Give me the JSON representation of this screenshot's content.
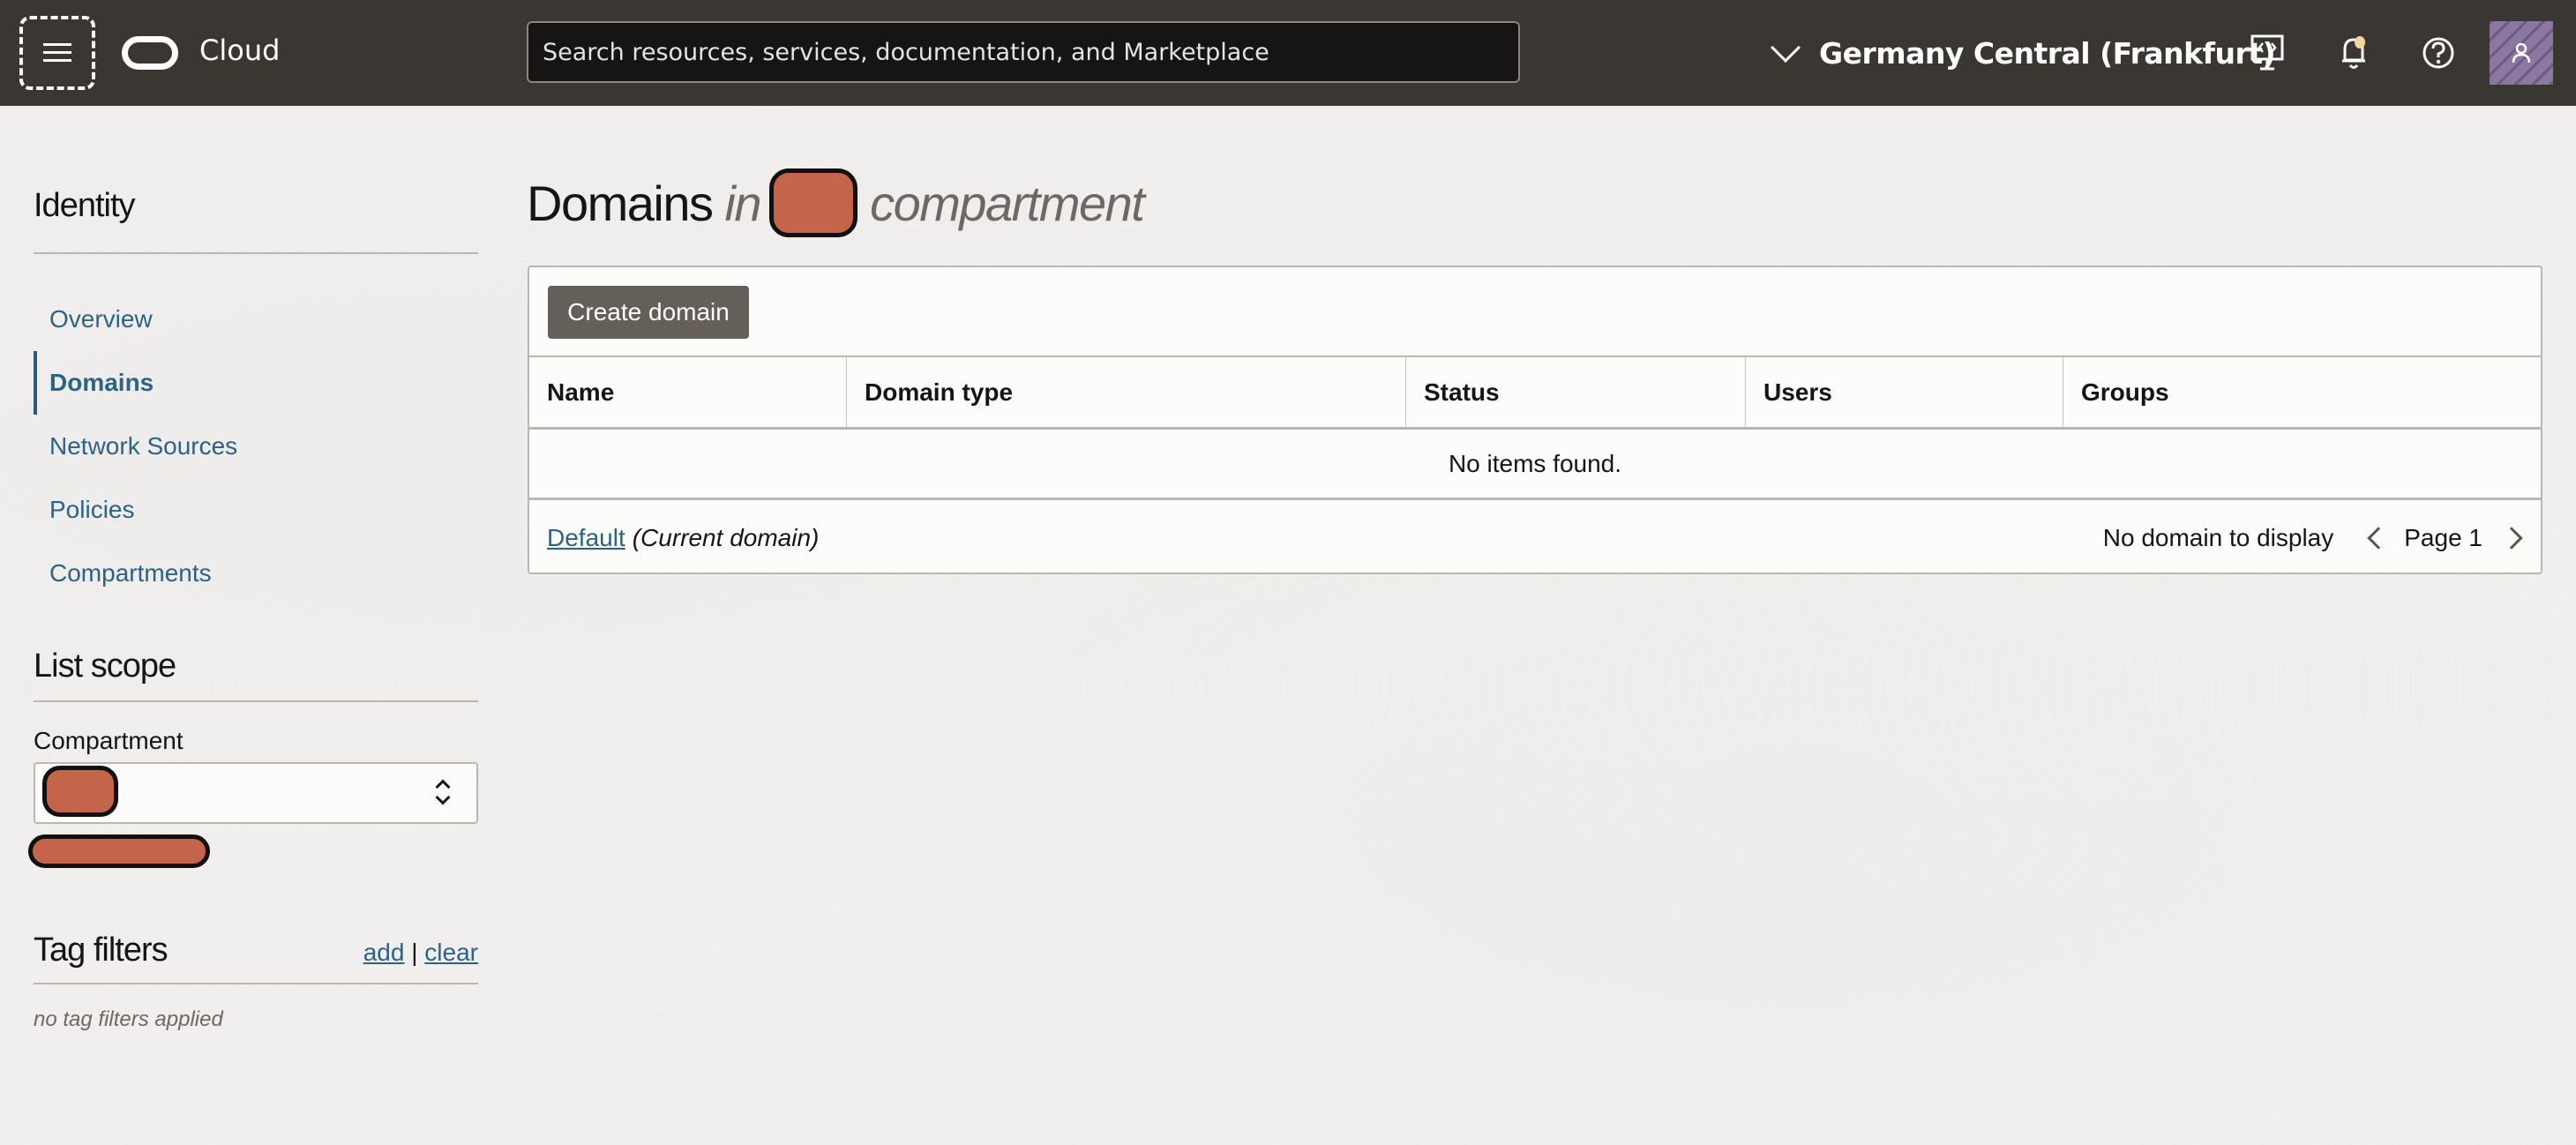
{
  "header": {
    "brand": "Cloud",
    "search_placeholder": "Search resources, services, documentation, and Marketplace",
    "region": "Germany Central (Frankfurt)",
    "icons": [
      "menu-icon",
      "oracle-logo-icon",
      "chevron-down-icon",
      "developer-tools-icon",
      "notifications-bell-icon",
      "help-icon",
      "user-avatar-icon"
    ]
  },
  "sidebar": {
    "title": "Identity",
    "nav": [
      {
        "label": "Overview",
        "active": false
      },
      {
        "label": "Domains",
        "active": true
      },
      {
        "label": "Network Sources",
        "active": false
      },
      {
        "label": "Policies",
        "active": false
      },
      {
        "label": "Compartments",
        "active": false
      }
    ],
    "list_scope": {
      "title": "List scope",
      "compartment_label": "Compartment",
      "compartment_value": "[redacted]",
      "compartment_path": "[redacted]"
    },
    "tag_filters": {
      "title": "Tag filters",
      "add_label": "add",
      "separator": "|",
      "clear_label": "clear",
      "empty_text": "no tag filters applied"
    }
  },
  "main": {
    "title_prefix": "Domains",
    "title_in": "in",
    "title_compartment": "[redacted]",
    "title_suffix": "compartment",
    "create_button": "Create domain",
    "table": {
      "columns": [
        "Name",
        "Domain type",
        "Status",
        "Users",
        "Groups"
      ],
      "rows": [],
      "empty_text": "No items found."
    },
    "footer": {
      "domain_link": "Default",
      "domain_note": "(Current domain)",
      "display_text": "No domain to display",
      "page_label": "Page 1"
    }
  },
  "colors": {
    "header_bg": "#3a3632",
    "link": "#2c6385",
    "primary_button": "#655f5a",
    "redaction": "#c4644b",
    "notification_dot": "#f0d89a",
    "avatar": "#7e6a92"
  }
}
